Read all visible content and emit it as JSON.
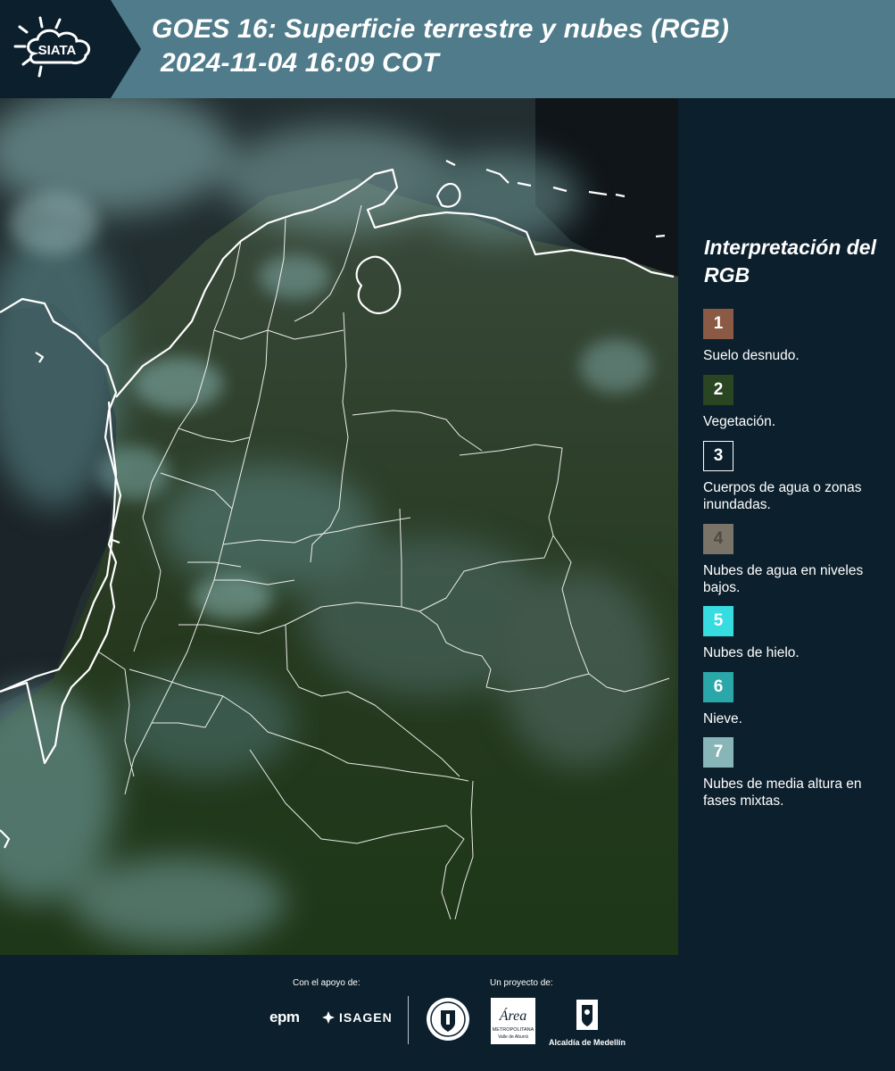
{
  "header": {
    "logo_text": "SIATA",
    "title_line1": "GOES 16: Superficie terrestre y nubes (RGB)",
    "title_line2": "2024-11-04 16:09 COT"
  },
  "legend": {
    "title": "Interpretación del RGB",
    "items": [
      {
        "number": "1",
        "label": "Suelo desnudo.",
        "color": "#8a5a45"
      },
      {
        "number": "2",
        "label": "Vegetación.",
        "color": "#2a4521"
      },
      {
        "number": "3",
        "label": "Cuerpos de agua o zonas inundadas.",
        "color": "#0c1f2c"
      },
      {
        "number": "4",
        "label": "Nubes de agua en niveles bajos.",
        "color": "#7a7367"
      },
      {
        "number": "5",
        "label": "Nubes de hielo.",
        "color": "#36dce0"
      },
      {
        "number": "6",
        "label": "Nieve.",
        "color": "#2aa7a8"
      },
      {
        "number": "7",
        "label": "Nubes de media altura en fases mixtas.",
        "color": "#88b5b8"
      }
    ]
  },
  "footer": {
    "support_label": "Con el apoyo de:",
    "project_label": "Un proyecto de:",
    "epm_text": "epm",
    "isagen_text": "ISAGEN",
    "area_text": "Área",
    "area_subtitle": "METROPOLITANA",
    "area_subtitle2": "Valle de Aburrá",
    "alcaldia_text": "Alcaldía de Medellín"
  },
  "colors": {
    "header_bg": "#4f7b8a",
    "panel_bg": "#0c1f2c",
    "border_lines": "#ffffff"
  }
}
